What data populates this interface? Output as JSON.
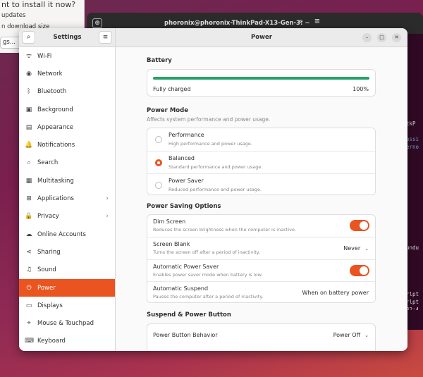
{
  "installer": {
    "question": "nt to install it now?",
    "updates": "updates",
    "download": "n download size",
    "select": "gs..."
  },
  "terminal": {
    "title": "phoronix@phoronix-ThinkPad-X13-Gen-3: ~",
    "lines": [
      "tkP",
      "",
      "essi",
      "erno",
      "",
      "",
      "",
      "",
      "",
      "",
      "",
      "",
      "",
      "",
      "",
      "",
      "undu",
      "",
      "",
      "",
      "",
      "",
      "rlpt",
      "rlpt",
      "32:4",
      "38:1"
    ]
  },
  "settings": {
    "sidebar_title": "Settings",
    "page_title": "Power",
    "sidebar_items": [
      {
        "label": "Wi-Fi",
        "icon": "wifi-icon",
        "glyph": "ᯤ"
      },
      {
        "label": "Network",
        "icon": "network-icon",
        "glyph": "◉"
      },
      {
        "label": "Bluetooth",
        "icon": "bluetooth-icon",
        "glyph": "ᛒ"
      },
      {
        "label": "Background",
        "icon": "background-icon",
        "glyph": "▣"
      },
      {
        "label": "Appearance",
        "icon": "appearance-icon",
        "glyph": "▤"
      },
      {
        "label": "Notifications",
        "icon": "bell-icon",
        "glyph": "🔔"
      },
      {
        "label": "Search",
        "icon": "search-icon",
        "glyph": "⌕"
      },
      {
        "label": "Multitasking",
        "icon": "multitasking-icon",
        "glyph": "▦"
      },
      {
        "label": "Applications",
        "icon": "applications-icon",
        "glyph": "⊞"
      },
      {
        "label": "Privacy",
        "icon": "lock-icon",
        "glyph": "🔒"
      },
      {
        "label": "Online Accounts",
        "icon": "cloud-icon",
        "glyph": "☁"
      },
      {
        "label": "Sharing",
        "icon": "share-icon",
        "glyph": "⋖"
      },
      {
        "label": "Sound",
        "icon": "music-note-icon",
        "glyph": "♫"
      },
      {
        "label": "Power",
        "icon": "power-icon",
        "glyph": "⏻"
      },
      {
        "label": "Displays",
        "icon": "display-icon",
        "glyph": "▭"
      },
      {
        "label": "Mouse & Touchpad",
        "icon": "mouse-icon",
        "glyph": "⌖"
      },
      {
        "label": "Keyboard",
        "icon": "keyboard-icon",
        "glyph": "⌨"
      }
    ]
  },
  "battery": {
    "section_title": "Battery",
    "status": "Fully charged",
    "percent_label": "100%",
    "level": 1.0
  },
  "power_mode": {
    "section_title": "Power Mode",
    "subtitle": "Affects system performance and power usage.",
    "selected": 1,
    "options": [
      {
        "label": "Performance",
        "desc": "High performance and power usage."
      },
      {
        "label": "Balanced",
        "desc": "Standard performance and power usage."
      },
      {
        "label": "Power Saver",
        "desc": "Reduced performance and power usage."
      }
    ]
  },
  "power_saving": {
    "section_title": "Power Saving Options",
    "dim_screen": {
      "label": "Dim Screen",
      "desc": "Reduces the screen brightness when the computer is inactive.",
      "enabled": true
    },
    "screen_blank": {
      "label": "Screen Blank",
      "desc": "Turns the screen off after a period of inactivity.",
      "value": "Never"
    },
    "auto_power_saver": {
      "label": "Automatic Power Saver",
      "desc": "Enables power saver mode when battery is low.",
      "enabled": true
    },
    "auto_suspend": {
      "label": "Automatic Suspend",
      "desc": "Pauses the computer after a period of inactivity.",
      "value": "When on battery power"
    }
  },
  "suspend": {
    "section_title": "Suspend & Power Button",
    "power_button": {
      "label": "Power Button Behavior",
      "value": "Power Off"
    }
  },
  "colors": {
    "accent": "#e95420",
    "battery": "#26a269"
  }
}
